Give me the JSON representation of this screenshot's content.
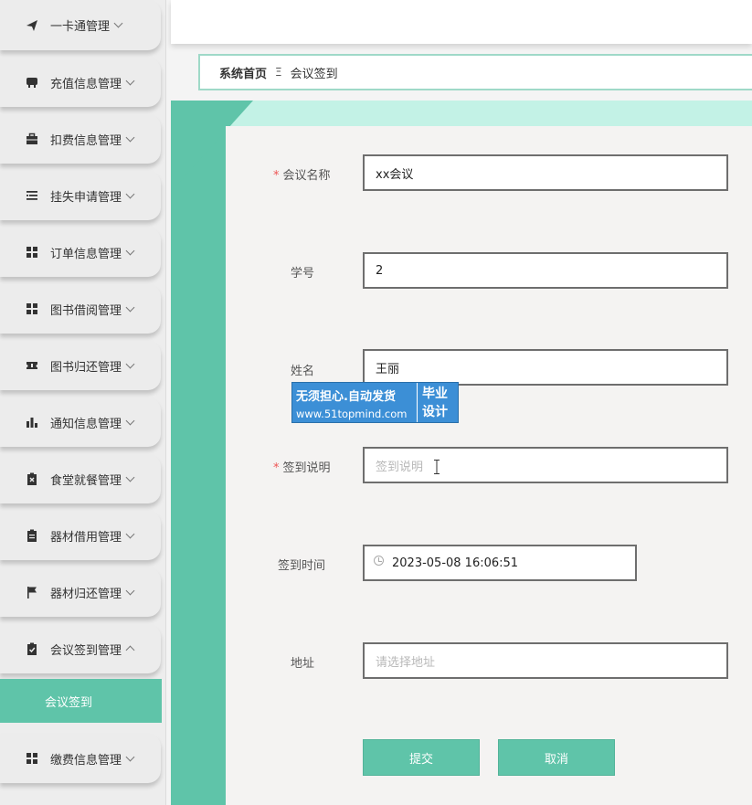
{
  "sidebar": {
    "items": [
      {
        "label": "一卡通管理",
        "icon": "paper-plane-icon",
        "expanded": false
      },
      {
        "label": "充值信息管理",
        "icon": "card-icon",
        "expanded": false
      },
      {
        "label": "扣费信息管理",
        "icon": "briefcase-icon",
        "expanded": false
      },
      {
        "label": "挂失申请管理",
        "icon": "list-icon",
        "expanded": false
      },
      {
        "label": "订单信息管理",
        "icon": "grid-icon",
        "expanded": false
      },
      {
        "label": "图书借阅管理",
        "icon": "grid-icon",
        "expanded": false
      },
      {
        "label": "图书归还管理",
        "icon": "ticket-icon",
        "expanded": false
      },
      {
        "label": "通知信息管理",
        "icon": "bar-chart-icon",
        "expanded": false
      },
      {
        "label": "食堂就餐管理",
        "icon": "clipboard-x-icon",
        "expanded": false
      },
      {
        "label": "器材借用管理",
        "icon": "clipboard-icon",
        "expanded": false
      },
      {
        "label": "器材归还管理",
        "icon": "flag-icon",
        "expanded": false
      },
      {
        "label": "会议签到管理",
        "icon": "clipboard-check-icon",
        "expanded": true
      },
      {
        "label": "缴费信息管理",
        "icon": "grid-icon",
        "expanded": false
      }
    ],
    "active_submenu": "会议签到"
  },
  "breadcrumb": {
    "home": "系统首页",
    "separator": "Ξ",
    "current": "会议签到"
  },
  "form": {
    "meeting_name": {
      "label": "会议名称",
      "required": true,
      "value": "xx会议"
    },
    "student_id": {
      "label": "学号",
      "required": false,
      "value": "2"
    },
    "name": {
      "label": "姓名",
      "required": false,
      "value": "王丽"
    },
    "checkin_note": {
      "label": "签到说明",
      "required": true,
      "placeholder": "签到说明"
    },
    "checkin_time": {
      "label": "签到时间",
      "required": false,
      "value": "2023-05-08 16:06:51"
    },
    "address": {
      "label": "地址",
      "required": false,
      "placeholder": "请选择地址"
    },
    "required_mark": "*",
    "submit_label": "提交",
    "cancel_label": "取消"
  },
  "watermark": {
    "line1": "无须担心.自动发货",
    "line2": "www.51topmind.com",
    "side": "毕业设计"
  },
  "colors": {
    "accent": "#5fc4a9",
    "accent_light": "#c3f2e6",
    "required": "#e55555",
    "watermark": "#3c8fd6"
  }
}
